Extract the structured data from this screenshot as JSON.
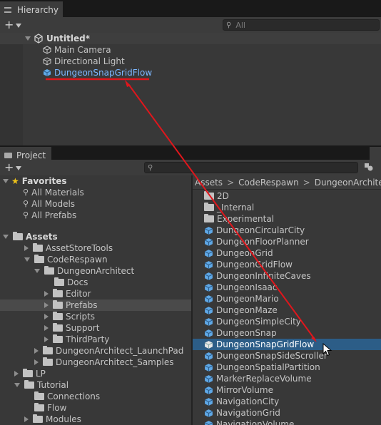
{
  "hierarchy": {
    "tab_label": "Hierarchy",
    "add_label": "+",
    "search_placeholder": "All",
    "scene_name": "Untitled*",
    "items": [
      "Main Camera",
      "Directional Light",
      "DungeonSnapGridFlow"
    ]
  },
  "project": {
    "tab_label": "Project",
    "add_label": "+",
    "favorites": {
      "label": "Favorites",
      "items": [
        "All Materials",
        "All Models",
        "All Prefabs"
      ]
    },
    "assets_tree": {
      "root": "Assets",
      "rows": [
        {
          "label": "AssetStoreTools",
          "level": 1,
          "expand": "closed"
        },
        {
          "label": "CodeRespawn",
          "level": 1,
          "expand": "open"
        },
        {
          "label": "DungeonArchitect",
          "level": 2,
          "expand": "open"
        },
        {
          "label": "Docs",
          "level": 3,
          "expand": "none"
        },
        {
          "label": "Editor",
          "level": 3,
          "expand": "closed"
        },
        {
          "label": "Prefabs",
          "level": 3,
          "expand": "closed"
        },
        {
          "label": "Scripts",
          "level": 3,
          "expand": "closed"
        },
        {
          "label": "Support",
          "level": 3,
          "expand": "closed"
        },
        {
          "label": "ThirdParty",
          "level": 3,
          "expand": "closed"
        },
        {
          "label": "DungeonArchitect_LaunchPad",
          "level": 2,
          "expand": "closed"
        },
        {
          "label": "DungeonArchitect_Samples",
          "level": 2,
          "expand": "closed"
        },
        {
          "label": "LP",
          "level": 0,
          "expand": "closed"
        },
        {
          "label": "Tutorial",
          "level": 0,
          "expand": "open"
        },
        {
          "label": "Connections",
          "level": 1,
          "expand": "none"
        },
        {
          "label": "Flow",
          "level": 1,
          "expand": "none"
        },
        {
          "label": "Modules",
          "level": 1,
          "expand": "closed"
        }
      ]
    },
    "breadcrumb": [
      "Assets",
      "CodeRespawn",
      "DungeonArchitect"
    ],
    "breadcrumb_separator": ">",
    "files": [
      {
        "label": "2D",
        "kind": "folder"
      },
      {
        "label": "_Internal",
        "kind": "folder"
      },
      {
        "label": "Experimental",
        "kind": "folder"
      },
      {
        "label": "DungeonCircularCity",
        "kind": "prefab"
      },
      {
        "label": "DungeonFloorPlanner",
        "kind": "prefab"
      },
      {
        "label": "DungeonGrid",
        "kind": "prefab"
      },
      {
        "label": "DungeonGridFlow",
        "kind": "prefab"
      },
      {
        "label": "DungeonInfiniteCaves",
        "kind": "prefab"
      },
      {
        "label": "DungeonIsaac",
        "kind": "prefab"
      },
      {
        "label": "DungeonMario",
        "kind": "prefab"
      },
      {
        "label": "DungeonMaze",
        "kind": "prefab"
      },
      {
        "label": "DungeonSimpleCity",
        "kind": "prefab"
      },
      {
        "label": "DungeonSnap",
        "kind": "prefab"
      },
      {
        "label": "DungeonSnapGridFlow",
        "kind": "prefab",
        "selected": true
      },
      {
        "label": "DungeonSnapSideScroller",
        "kind": "prefab"
      },
      {
        "label": "DungeonSpatialPartition",
        "kind": "prefab"
      },
      {
        "label": "MarkerReplaceVolume",
        "kind": "prefab"
      },
      {
        "label": "MirrorVolume",
        "kind": "prefab"
      },
      {
        "label": "NavigationCity",
        "kind": "prefab"
      },
      {
        "label": "NavigationGrid",
        "kind": "prefab"
      },
      {
        "label": "NavigationVolume",
        "kind": "prefab"
      }
    ]
  },
  "annotation": {
    "color": "#e0161c"
  },
  "colors": {
    "selection": "#2c5d87",
    "link_text": "#7cb7ff"
  }
}
